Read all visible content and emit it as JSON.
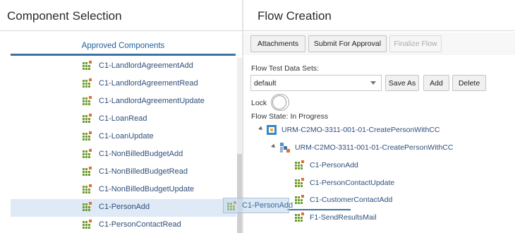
{
  "component_selection": {
    "title": "Component Selection",
    "tab_label": "Approved Components",
    "components": [
      {
        "label": "C1-LandlordAgreementAdd",
        "icon": "component-icon",
        "selected": false
      },
      {
        "label": "C1-LandlordAgreementRead",
        "icon": "component-icon",
        "selected": false
      },
      {
        "label": "C1-LandlordAgreementUpdate",
        "icon": "component-icon",
        "selected": false
      },
      {
        "label": "C1-LoanRead",
        "icon": "component-icon",
        "selected": false
      },
      {
        "label": "C1-LoanUpdate",
        "icon": "component-icon",
        "selected": false
      },
      {
        "label": "C1-NonBilledBudgetAdd",
        "icon": "component-icon",
        "selected": false
      },
      {
        "label": "C1-NonBilledBudgetRead",
        "icon": "component-icon",
        "selected": false
      },
      {
        "label": "C1-NonBilledBudgetUpdate",
        "icon": "component-icon",
        "selected": false
      },
      {
        "label": "C1-PersonAdd",
        "icon": "component-icon",
        "selected": true
      },
      {
        "label": "C1-PersonContactRead",
        "icon": "component-icon",
        "selected": false
      }
    ]
  },
  "flow_creation": {
    "title": "Flow Creation",
    "toolbar": {
      "attachments_label": "Attachments",
      "submit_label": "Submit For Approval",
      "finalize_label": "Finalize Flow"
    },
    "data_sets_label": "Flow Test Data Sets:",
    "data_set_selected": "default",
    "save_as_label": "Save As",
    "add_label": "Add",
    "delete_label": "Delete",
    "lock_label": "Lock",
    "lock_on": false,
    "flow_state_label": "Flow State: In Progress",
    "tree": {
      "root_label": "URM-C2MO-3311-001-01-CreatePersonWithCC",
      "root_icon": "flow-icon",
      "child_label": "URM-C2MO-3311-001-01-CreatePersonWithCC",
      "child_icon": "process-icon",
      "leaves": [
        {
          "label": "C1-PersonAdd",
          "icon": "component-icon"
        },
        {
          "label": "C1-PersonContactUpdate",
          "icon": "component-icon"
        },
        {
          "label": "C1-CustomerContactAdd",
          "icon": "component-icon"
        },
        {
          "label": "F1-SendResultsMail",
          "icon": "component-icon"
        }
      ]
    }
  },
  "drag_ghost": {
    "label": "C1-PersonAdd",
    "icon": "component-icon"
  },
  "colors": {
    "accent": "#3b73a8",
    "selection": "#dfeaf6",
    "link_text": "#2f4f7a",
    "icon_green": "#6e9c2e",
    "icon_orange": "#e0702a"
  }
}
